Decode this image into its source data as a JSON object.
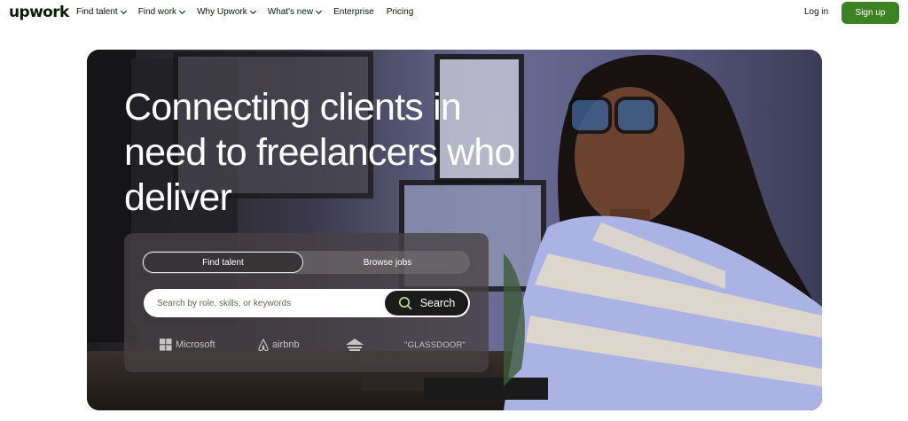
{
  "header": {
    "logo": "upwork",
    "nav": [
      {
        "label": "Find talent",
        "dropdown": true
      },
      {
        "label": "Find work",
        "dropdown": true
      },
      {
        "label": "Why Upwork",
        "dropdown": true
      },
      {
        "label": "What's new",
        "dropdown": true
      },
      {
        "label": "Enterprise",
        "dropdown": false
      },
      {
        "label": "Pricing",
        "dropdown": false
      }
    ],
    "login": "Log in",
    "signup": "Sign up"
  },
  "hero": {
    "title": "Connecting clients in need to freelancers who deliver",
    "tabs": {
      "active": "Find talent",
      "other": "Browse jobs"
    },
    "search": {
      "placeholder": "Search by role, skills, or keywords",
      "button": "Search"
    },
    "brands": [
      "Microsoft",
      "airbnb",
      "bissell-logo",
      "\"GLASSDOOR\""
    ]
  },
  "colors": {
    "brand_green": "#3c8224",
    "text": "#001e00"
  }
}
